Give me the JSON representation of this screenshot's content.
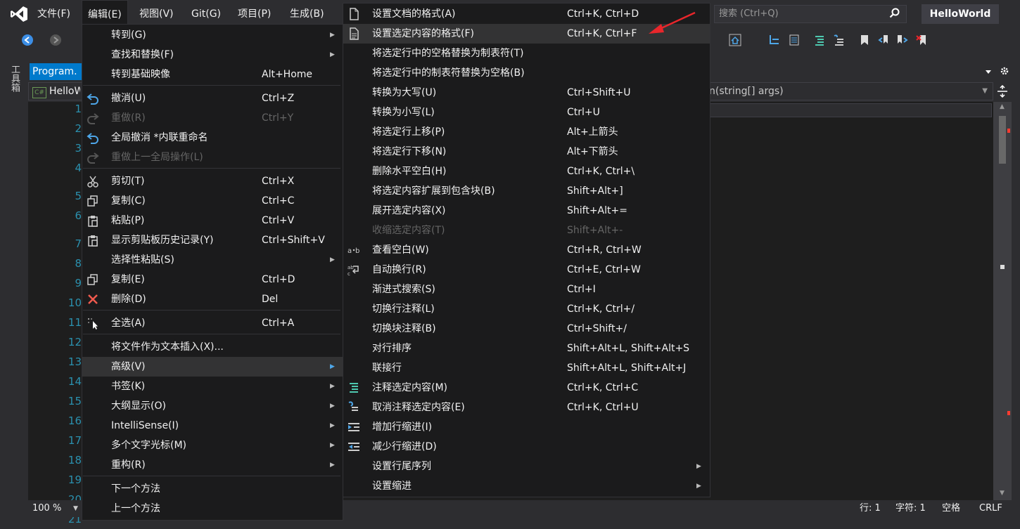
{
  "menubar": {
    "items": [
      "文件(F)",
      "编辑(E)",
      "视图(V)",
      "Git(G)",
      "项目(P)",
      "生成(B)"
    ],
    "search_placeholder": "搜索 (Ctrl+Q)",
    "project_name": "HelloWorld"
  },
  "toolbox": {
    "label": "工具箱"
  },
  "editor": {
    "tab_title": "Program.",
    "nav_left": "HelloW",
    "nav_right": "n(string[] args)",
    "line_numbers": [
      "1",
      "2",
      "3",
      "4",
      "5",
      "6",
      "7",
      "8",
      "9",
      "10",
      "11",
      "12",
      "13",
      "14",
      "15",
      "16",
      "17",
      "18",
      "19",
      "20",
      "21"
    ]
  },
  "statusbar": {
    "zoom": "100 %",
    "line": "行: 1",
    "char": "字符: 1",
    "spaces": "空格",
    "eol": "CRLF"
  },
  "edit_menu": {
    "items": [
      {
        "label": "转到(G)",
        "shortcut": "",
        "submenu": true,
        "disabled": false,
        "icon": ""
      },
      {
        "label": "查找和替换(F)",
        "shortcut": "",
        "submenu": true,
        "disabled": false,
        "icon": ""
      },
      {
        "label": "转到基础映像",
        "shortcut": "Alt+Home",
        "submenu": false,
        "disabled": false,
        "icon": ""
      },
      {
        "label": "撤消(U)",
        "shortcut": "Ctrl+Z",
        "submenu": false,
        "disabled": false,
        "icon": "undo-icon"
      },
      {
        "label": "重做(R)",
        "shortcut": "Ctrl+Y",
        "submenu": false,
        "disabled": true,
        "icon": "redo-icon"
      },
      {
        "label": "全局撤消 *内联重命名",
        "shortcut": "",
        "submenu": false,
        "disabled": false,
        "icon": "undo-icon"
      },
      {
        "label": "重做上一全局操作(L)",
        "shortcut": "",
        "submenu": false,
        "disabled": true,
        "icon": "redo-icon"
      },
      {
        "label": "剪切(T)",
        "shortcut": "Ctrl+X",
        "submenu": false,
        "disabled": false,
        "icon": "scissors-icon"
      },
      {
        "label": "复制(C)",
        "shortcut": "Ctrl+C",
        "submenu": false,
        "disabled": false,
        "icon": "copy-icon"
      },
      {
        "label": "粘贴(P)",
        "shortcut": "Ctrl+V",
        "submenu": false,
        "disabled": false,
        "icon": "paste-icon"
      },
      {
        "label": "显示剪贴板历史记录(Y)",
        "shortcut": "Ctrl+Shift+V",
        "submenu": false,
        "disabled": false,
        "icon": "paste-icon"
      },
      {
        "label": "选择性粘贴(S)",
        "shortcut": "",
        "submenu": true,
        "disabled": false,
        "icon": ""
      },
      {
        "label": "复制(E)",
        "shortcut": "Ctrl+D",
        "submenu": false,
        "disabled": false,
        "icon": "copy-icon"
      },
      {
        "label": "删除(D)",
        "shortcut": "Del",
        "submenu": false,
        "disabled": false,
        "icon": "delete-icon"
      },
      {
        "label": "全选(A)",
        "shortcut": "Ctrl+A",
        "submenu": false,
        "disabled": false,
        "icon": "select-all-icon"
      },
      {
        "label": "将文件作为文本插入(X)...",
        "shortcut": "",
        "submenu": false,
        "disabled": false,
        "icon": ""
      },
      {
        "label": "高级(V)",
        "shortcut": "",
        "submenu": true,
        "disabled": false,
        "icon": "",
        "highlighted": true
      },
      {
        "label": "书签(K)",
        "shortcut": "",
        "submenu": true,
        "disabled": false,
        "icon": ""
      },
      {
        "label": "大纲显示(O)",
        "shortcut": "",
        "submenu": true,
        "disabled": false,
        "icon": ""
      },
      {
        "label": "IntelliSense(I)",
        "shortcut": "",
        "submenu": true,
        "disabled": false,
        "icon": ""
      },
      {
        "label": "多个文字光标(M)",
        "shortcut": "",
        "submenu": true,
        "disabled": false,
        "icon": ""
      },
      {
        "label": "重构(R)",
        "shortcut": "",
        "submenu": true,
        "disabled": false,
        "icon": ""
      },
      {
        "label": "下一个方法",
        "shortcut": "",
        "submenu": false,
        "disabled": false,
        "icon": ""
      },
      {
        "label": "上一个方法",
        "shortcut": "",
        "submenu": false,
        "disabled": false,
        "icon": ""
      }
    ]
  },
  "advanced_menu": {
    "items": [
      {
        "label": "设置文档的格式(A)",
        "shortcut": "Ctrl+K, Ctrl+D",
        "submenu": false,
        "disabled": false,
        "icon": "document-format-icon"
      },
      {
        "label": "设置选定内容的格式(F)",
        "shortcut": "Ctrl+K, Ctrl+F",
        "submenu": false,
        "disabled": false,
        "icon": "selection-format-icon",
        "highlighted": true
      },
      {
        "label": "将选定行中的空格替换为制表符(T)",
        "shortcut": "",
        "submenu": false,
        "disabled": false,
        "icon": ""
      },
      {
        "label": "将选定行中的制表符替换为空格(B)",
        "shortcut": "",
        "submenu": false,
        "disabled": false,
        "icon": ""
      },
      {
        "label": "转换为大写(U)",
        "shortcut": "Ctrl+Shift+U",
        "submenu": false,
        "disabled": false,
        "icon": ""
      },
      {
        "label": "转换为小写(L)",
        "shortcut": "Ctrl+U",
        "submenu": false,
        "disabled": false,
        "icon": ""
      },
      {
        "label": "将选定行上移(P)",
        "shortcut": "Alt+上箭头",
        "submenu": false,
        "disabled": false,
        "icon": ""
      },
      {
        "label": "将选定行下移(N)",
        "shortcut": "Alt+下箭头",
        "submenu": false,
        "disabled": false,
        "icon": ""
      },
      {
        "label": "删除水平空白(H)",
        "shortcut": "Ctrl+K, Ctrl+\\",
        "submenu": false,
        "disabled": false,
        "icon": ""
      },
      {
        "label": "将选定内容扩展到包含块(B)",
        "shortcut": "Shift+Alt+]",
        "submenu": false,
        "disabled": false,
        "icon": ""
      },
      {
        "label": "展开选定内容(X)",
        "shortcut": "Shift+Alt+=",
        "submenu": false,
        "disabled": false,
        "icon": ""
      },
      {
        "label": "收缩选定内容(T)",
        "shortcut": "Shift+Alt+-",
        "submenu": false,
        "disabled": true,
        "icon": ""
      },
      {
        "label": "查看空白(W)",
        "shortcut": "Ctrl+R, Ctrl+W",
        "submenu": false,
        "disabled": false,
        "icon": "whitespace-icon"
      },
      {
        "label": "自动换行(R)",
        "shortcut": "Ctrl+E, Ctrl+W",
        "submenu": false,
        "disabled": false,
        "icon": "word-wrap-icon"
      },
      {
        "label": "渐进式搜索(S)",
        "shortcut": "Ctrl+I",
        "submenu": false,
        "disabled": false,
        "icon": ""
      },
      {
        "label": "切换行注释(L)",
        "shortcut": "Ctrl+K, Ctrl+/",
        "submenu": false,
        "disabled": false,
        "icon": ""
      },
      {
        "label": "切换块注释(B)",
        "shortcut": "Ctrl+Shift+/",
        "submenu": false,
        "disabled": false,
        "icon": ""
      },
      {
        "label": "对行排序",
        "shortcut": "Shift+Alt+L, Shift+Alt+S",
        "submenu": false,
        "disabled": false,
        "icon": ""
      },
      {
        "label": "联接行",
        "shortcut": "Shift+Alt+L, Shift+Alt+J",
        "submenu": false,
        "disabled": false,
        "icon": ""
      },
      {
        "label": "注释选定内容(M)",
        "shortcut": "Ctrl+K, Ctrl+C",
        "submenu": false,
        "disabled": false,
        "icon": "comment-icon"
      },
      {
        "label": "取消注释选定内容(E)",
        "shortcut": "Ctrl+K, Ctrl+U",
        "submenu": false,
        "disabled": false,
        "icon": "uncomment-icon"
      },
      {
        "label": "增加行缩进(I)",
        "shortcut": "",
        "submenu": false,
        "disabled": false,
        "icon": "indent-icon"
      },
      {
        "label": "减少行缩进(D)",
        "shortcut": "",
        "submenu": false,
        "disabled": false,
        "icon": "outdent-icon"
      },
      {
        "label": "设置行尾序列",
        "shortcut": "",
        "submenu": true,
        "disabled": false,
        "icon": ""
      },
      {
        "label": "设置缩进",
        "shortcut": "",
        "submenu": true,
        "disabled": false,
        "icon": ""
      }
    ]
  },
  "colors": {
    "accent": "#007acc",
    "menu_bg": "#1b1b1c",
    "annotation_arrow": "#e8262b"
  }
}
